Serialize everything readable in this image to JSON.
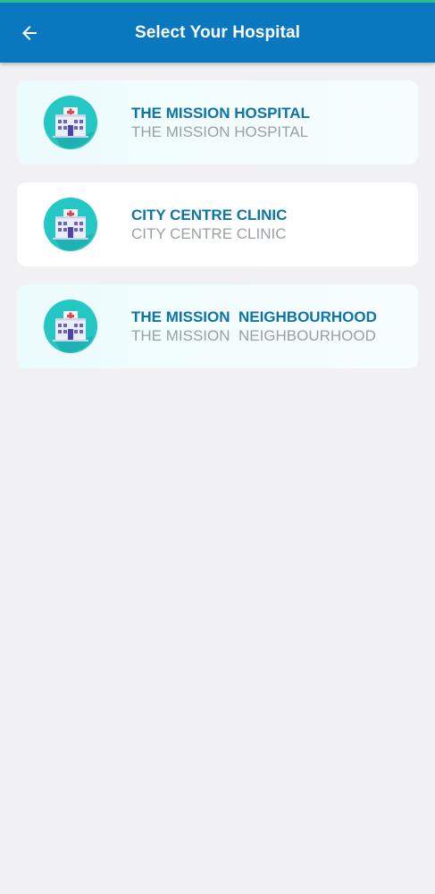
{
  "header": {
    "title": "Select Your Hospital",
    "back_icon": "arrow-left-icon"
  },
  "colors": {
    "app_bar": "#0a78be",
    "top_accent": "#2fbf8a",
    "title_text": "#0d74a8",
    "subtitle_text": "#9aa0a4",
    "background": "#f1f1f3"
  },
  "hospitals": [
    {
      "title": "THE MISSION HOSPITAL",
      "subtitle": "THE MISSION HOSPITAL",
      "icon": "hospital-building-icon"
    },
    {
      "title": "CITY CENTRE CLINIC",
      "subtitle": "CITY CENTRE CLINIC",
      "icon": "hospital-building-icon"
    },
    {
      "title": "THE MISSION  NEIGHBOURHOOD",
      "subtitle": "THE MISSION  NEIGHBOURHOOD",
      "icon": "hospital-building-icon"
    }
  ]
}
